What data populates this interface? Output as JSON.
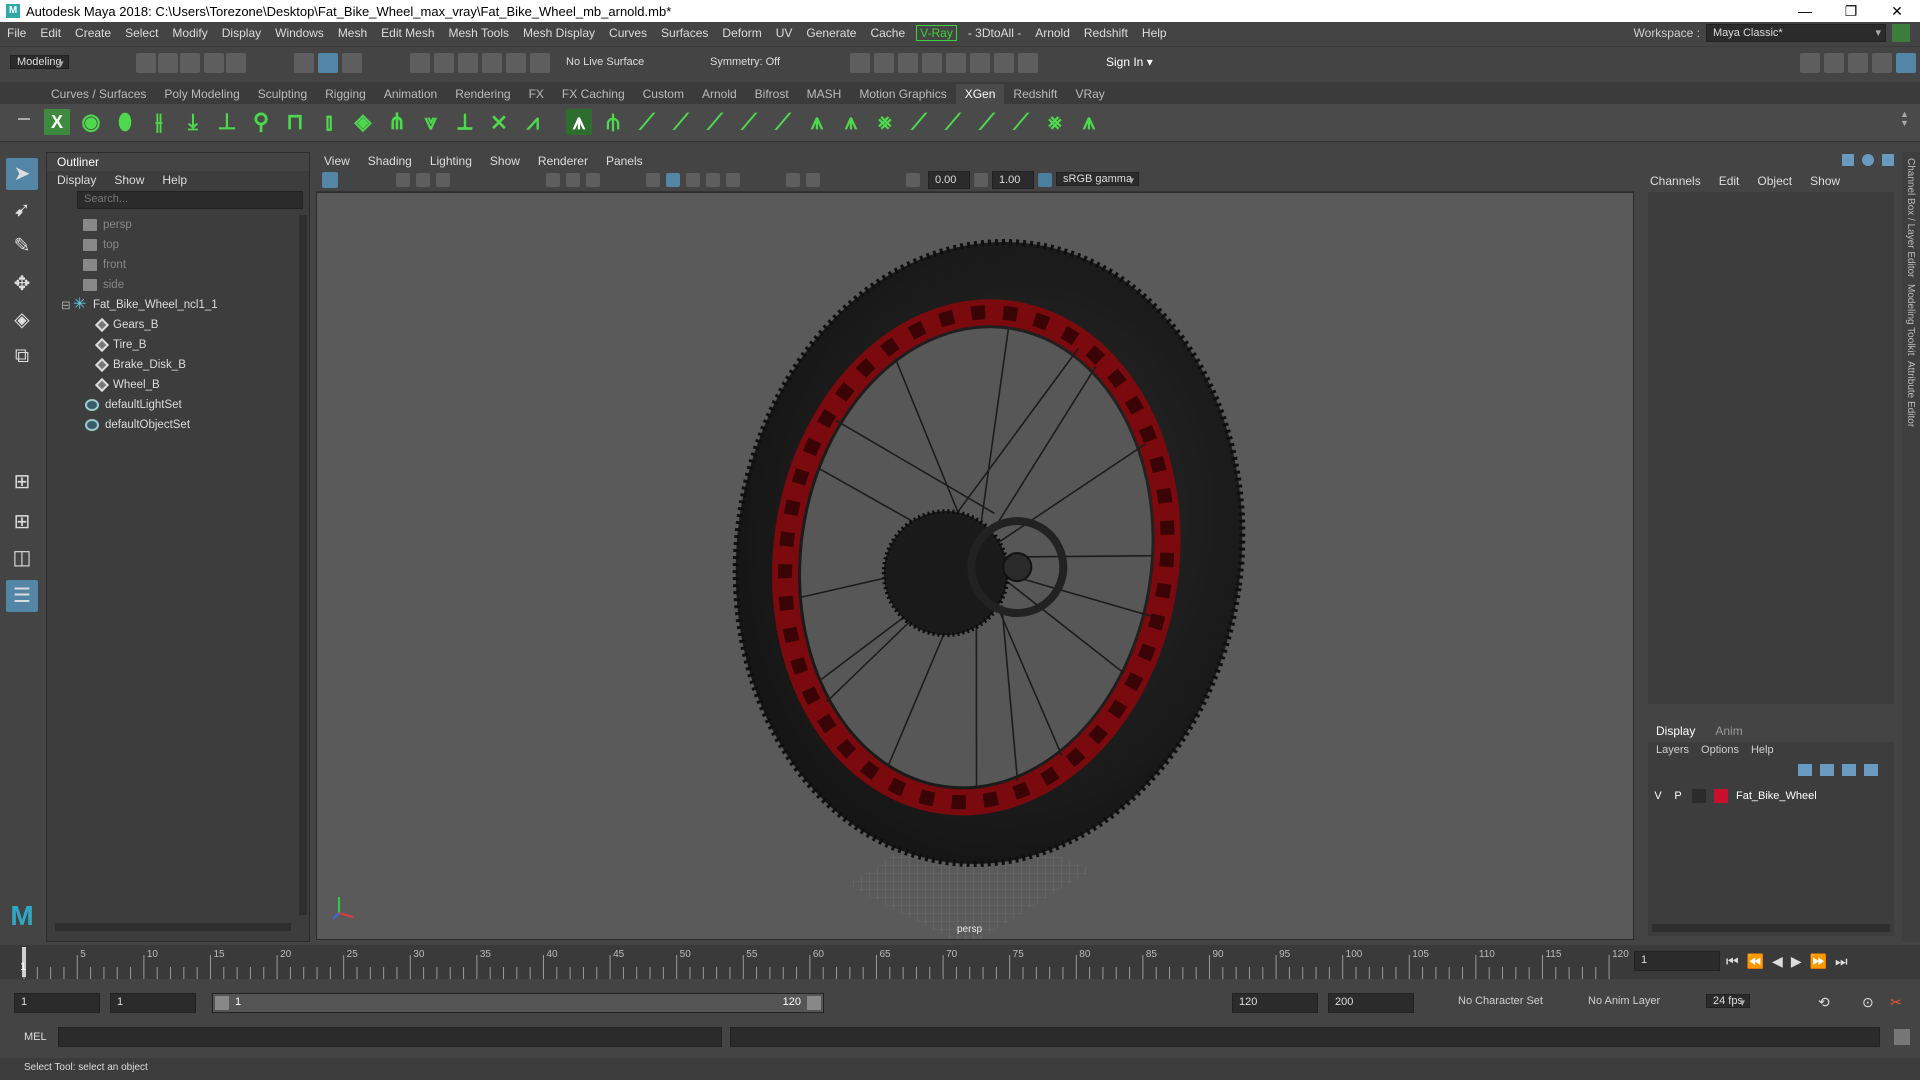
{
  "window": {
    "title": "Autodesk Maya 2018: C:\\Users\\Torezone\\Desktop\\Fat_Bike_Wheel_max_vray\\Fat_Bike_Wheel_mb_arnold.mb*",
    "minimize": "—",
    "restore": "❐",
    "close": "✕"
  },
  "menubar": {
    "items": [
      "File",
      "Edit",
      "Create",
      "Select",
      "Modify",
      "Display",
      "Windows",
      "Mesh",
      "Edit Mesh",
      "Mesh Tools",
      "Mesh Display",
      "Curves",
      "Surfaces",
      "Deform",
      "UV",
      "Generate",
      "Cache"
    ],
    "vray": "V-Ray",
    "items2": [
      "- 3DtoAll -",
      "Arnold",
      "Redshift",
      "Help"
    ],
    "workspace_label": "Workspace :",
    "workspace_value": "Maya Classic*"
  },
  "statusline": {
    "mode": "Modeling",
    "live_surface": "No Live Surface",
    "symmetry": "Symmetry: Off",
    "sign_in": "Sign In"
  },
  "shelf": {
    "tabs": [
      "Curves / Surfaces",
      "Poly Modeling",
      "Sculpting",
      "Rigging",
      "Animation",
      "Rendering",
      "FX",
      "FX Caching",
      "Custom",
      "Arnold",
      "Bifrost",
      "MASH",
      "Motion Graphics",
      "XGen",
      "Redshift",
      "VRay"
    ],
    "active_tab": "XGen",
    "accent": "#4ed84e"
  },
  "outliner": {
    "title": "Outliner",
    "menu": [
      "Display",
      "Show",
      "Help"
    ],
    "search_placeholder": "Search...",
    "items": [
      {
        "label": "persp",
        "type": "camera",
        "dim": true
      },
      {
        "label": "top",
        "type": "camera",
        "dim": true
      },
      {
        "label": "front",
        "type": "camera",
        "dim": true
      },
      {
        "label": "side",
        "type": "camera",
        "dim": true
      },
      {
        "label": "Fat_Bike_Wheel_ncl1_1",
        "type": "group",
        "dim": false
      },
      {
        "label": "Gears_B",
        "type": "mesh",
        "dim": false
      },
      {
        "label": "Tire_B",
        "type": "mesh",
        "dim": false
      },
      {
        "label": "Brake_Disk_B",
        "type": "mesh",
        "dim": false
      },
      {
        "label": "Wheel_B",
        "type": "mesh",
        "dim": false
      },
      {
        "label": "defaultLightSet",
        "type": "set",
        "dim": false
      },
      {
        "label": "defaultObjectSet",
        "type": "set",
        "dim": false
      }
    ]
  },
  "viewport": {
    "menu": [
      "View",
      "Shading",
      "Lighting",
      "Show",
      "Renderer",
      "Panels"
    ],
    "exposure": "0.00",
    "gamma": "1.00",
    "color_space": "sRGB gamma",
    "camera_label": "persp",
    "rim_color": "#7a0a0e",
    "tire_color": "#1e1e1e"
  },
  "channelbox": {
    "menu": [
      "Channels",
      "Edit",
      "Object",
      "Show"
    ],
    "vertical_tabs": [
      "Channel Box / Layer Editor",
      "Modeling Toolkit",
      "Attribute Editor"
    ]
  },
  "layers": {
    "tabs": [
      "Display",
      "Anim"
    ],
    "active_tab": "Display",
    "menu": [
      "Layers",
      "Options",
      "Help"
    ],
    "rows": [
      {
        "v": "V",
        "p": "P",
        "name": "Fat_Bike_Wheel",
        "color": "#c8102e"
      }
    ]
  },
  "timeline": {
    "ticks": [
      "5",
      "10",
      "15",
      "20",
      "25",
      "30",
      "35",
      "40",
      "45",
      "50",
      "55",
      "60",
      "65",
      "70",
      "75",
      "80",
      "85",
      "90",
      "95",
      "100",
      "105",
      "110",
      "115",
      "120"
    ],
    "first": "1",
    "current_frame": "1"
  },
  "range": {
    "start": "1",
    "playback_start": "1",
    "slider_start": "1",
    "slider_end": "120",
    "playback_end": "120",
    "end": "200",
    "character_set": "No Character Set",
    "anim_layer": "No Anim Layer",
    "fps": "24 fps"
  },
  "commandline": {
    "label": "MEL"
  },
  "helpline": {
    "text": "Select Tool: select an object"
  }
}
